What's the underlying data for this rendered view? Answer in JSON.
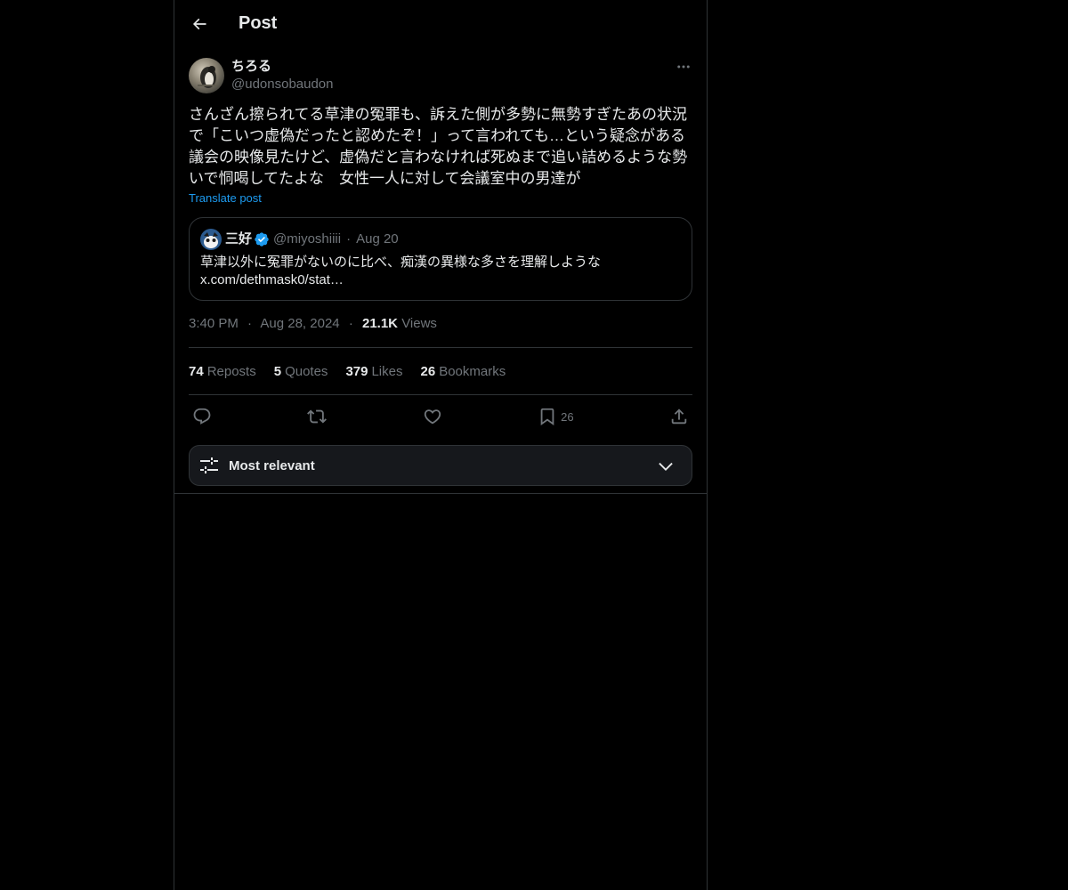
{
  "header": {
    "title": "Post"
  },
  "post": {
    "display_name": "ちろる",
    "handle": "@udonsobaudon",
    "text": "さんざん擦られてる草津の冤罪も、訴えた側が多勢に無勢すぎたあの状況で「こいつ虚偽だったと認めたぞ！」って言われても…という疑念がある\n議会の映像見たけど、虚偽だと言わなければ死ぬまで追い詰めるような勢いで恫喝してたよな　女性一人に対して会議室中の男達が",
    "translate_label": "Translate post",
    "quote": {
      "name": "三好",
      "handle": "@miyoshiiii",
      "separator": "·",
      "date": "Aug 20",
      "body_line1": "草津以外に冤罪がないのに比べ、痴漢の異様な多さを理解しような",
      "body_line2": "x.com/dethmask0/stat…"
    },
    "meta": {
      "time": "3:40 PM",
      "date": "Aug 28, 2024",
      "separator": "·",
      "views_count": "21.1K",
      "views_label": "Views"
    },
    "stats": [
      {
        "count": "74",
        "label": "Reposts"
      },
      {
        "count": "5",
        "label": "Quotes"
      },
      {
        "count": "379",
        "label": "Likes"
      },
      {
        "count": "26",
        "label": "Bookmarks"
      }
    ],
    "actions": {
      "bookmark_count": "26"
    }
  },
  "sort": {
    "label": "Most relevant"
  },
  "colors": {
    "background": "#000000",
    "text": "#e7e9ea",
    "muted": "#71767b",
    "accent": "#1d9bf0",
    "border": "#2f3336"
  },
  "icons": {
    "back": "back-arrow-icon",
    "more": "more-horizontal-icon",
    "verified": "verified-badge-icon",
    "reply": "reply-icon",
    "repost": "repost-icon",
    "like": "heart-icon",
    "bookmark": "bookmark-icon",
    "share": "share-icon",
    "sort": "sliders-icon",
    "chevron": "chevron-down-icon"
  }
}
